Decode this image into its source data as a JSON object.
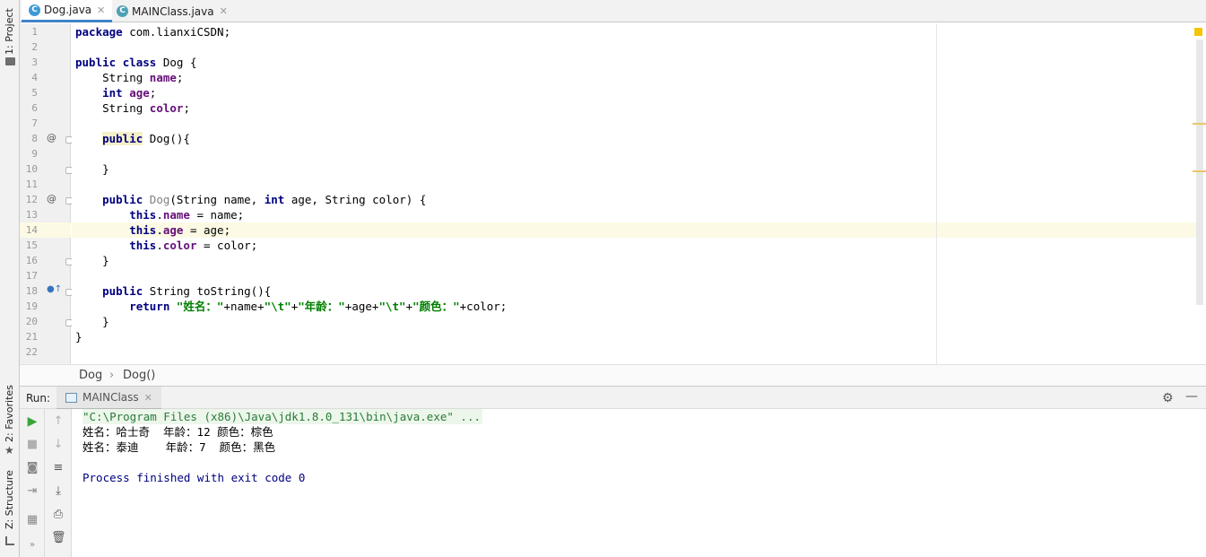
{
  "tool_strip": {
    "project": "1: Project",
    "favorites": "2: Favorites",
    "structure": "Z: Structure"
  },
  "editor_tabs": [
    {
      "label": "Dog.java",
      "active": true
    },
    {
      "label": "MAINClass.java",
      "active": false
    }
  ],
  "code": {
    "line_numbers": [
      "1",
      "2",
      "3",
      "4",
      "5",
      "6",
      "7",
      "8",
      "9",
      "10",
      "11",
      "12",
      "13",
      "14",
      "15",
      "16",
      "17",
      "18",
      "19",
      "20",
      "21",
      "22"
    ],
    "line1": {
      "kw": "package",
      "rest": " com.lianxiCSDN;"
    },
    "line3": {
      "kw1": "public",
      "kw2": "class",
      "rest": " Dog {"
    },
    "line4": {
      "type": "    String ",
      "field": "name",
      "end": ";"
    },
    "line5": {
      "kw": "    int",
      "field": "age",
      "end": ";"
    },
    "line6": {
      "type": "    String ",
      "field": "color",
      "end": ";"
    },
    "line8": {
      "indent": "    ",
      "kw": "public",
      "rest": " Dog(){"
    },
    "line10": "    }",
    "line12": {
      "kw": "    public",
      "name": "Dog",
      "p1": "(String name, ",
      "kw2": "int",
      "p2": " age, String color) {"
    },
    "line13": {
      "kw": "        this",
      "field": "name",
      "rest": " = name;"
    },
    "line14": {
      "kw": "        this",
      "field": "age",
      "rest": " = age;"
    },
    "line15": {
      "kw": "        this",
      "field": "color",
      "rest": " = color;"
    },
    "line16": "    }",
    "line18": {
      "kw": "    public",
      "rest": " String toString(){"
    },
    "line19": {
      "kw": "        return",
      "s1": "\"姓名：\"",
      "p1": "+name+",
      "s2": "\"\\t\"",
      "p2": "+",
      "s3": "\"年龄：\"",
      "p3": "+age+",
      "s4": "\"\\t\"",
      "p4": "+",
      "s5": "\"颜色：\"",
      "p5": "+color;"
    },
    "line20": "    }",
    "line21": "}",
    "gutter_marks": {
      "at": "@",
      "override": "●↑"
    }
  },
  "breadcrumb": {
    "item1": "Dog",
    "sep": "›",
    "item2": "Dog()"
  },
  "run_panel": {
    "label": "Run:",
    "tab": "MAINClass",
    "console": {
      "cmd": "\"C:\\Program Files (x86)\\Java\\jdk1.8.0_131\\bin\\java.exe\" ...",
      "out1": "姓名：哈士奇  年龄：12 颜色：棕色",
      "out2": "姓名：泰迪    年龄：7  颜色：黑色",
      "exit": "Process finished with exit code 0"
    }
  },
  "colors": {
    "keyword": "#000080",
    "field": "#660e7a",
    "string": "#008000",
    "caret_line": "#fcfae4"
  }
}
